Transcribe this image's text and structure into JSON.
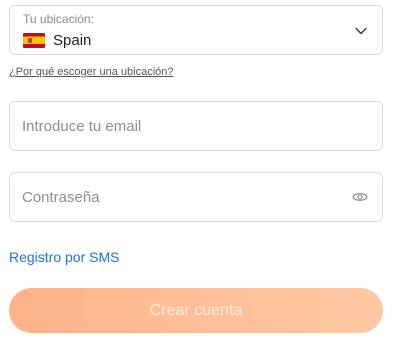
{
  "location": {
    "label": "Tu ubicación:",
    "value": "Spain",
    "flag_icon": "spain-flag-icon",
    "dropdown_icon": "chevron-down-icon"
  },
  "why_location_link": "¿Por qué escoger una ubicación?",
  "email": {
    "placeholder": "Introduce tu email",
    "value": ""
  },
  "password": {
    "placeholder": "Contraseña",
    "value": "",
    "toggle_icon": "eye-icon"
  },
  "sms_link": "Registro por SMS",
  "create_button": "Crear cuenta",
  "colors": {
    "link": "#1a73e8",
    "button_gradient_start": "#ffb38a",
    "button_gradient_end": "#ffc9a4",
    "border": "#dcdcdc"
  }
}
